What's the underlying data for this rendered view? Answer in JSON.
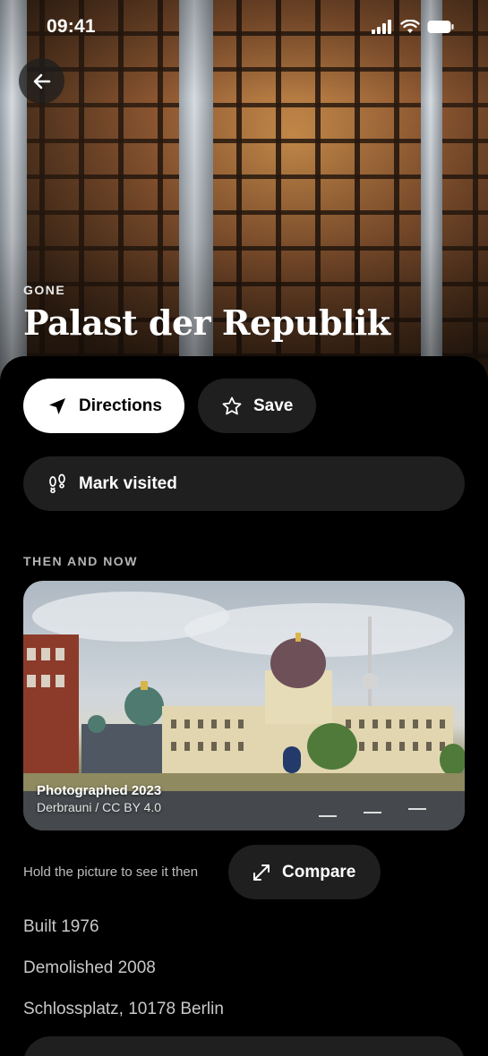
{
  "status_bar": {
    "time": "09:41"
  },
  "hero": {
    "kicker": "GONE",
    "title": "Palast der Republik"
  },
  "actions": {
    "directions_label": "Directions",
    "save_label": "Save",
    "mark_visited_label": "Mark visited"
  },
  "then_and_now": {
    "section_label": "THEN AND NOW",
    "photo_caption": "Photographed 2023",
    "photo_credit": "Derbrauni / CC BY 4.0",
    "hint": "Hold the picture to see it then",
    "compare_label": "Compare"
  },
  "facts": {
    "built": "Built 1976",
    "demolished": "Demolished 2008",
    "address": "Schlossplatz, 10178 Berlin"
  },
  "icons": [
    "back-arrow-icon",
    "navigation-arrow-icon",
    "star-icon",
    "footprints-icon",
    "expand-arrows-icon",
    "signal-icon",
    "wifi-icon",
    "battery-icon"
  ]
}
